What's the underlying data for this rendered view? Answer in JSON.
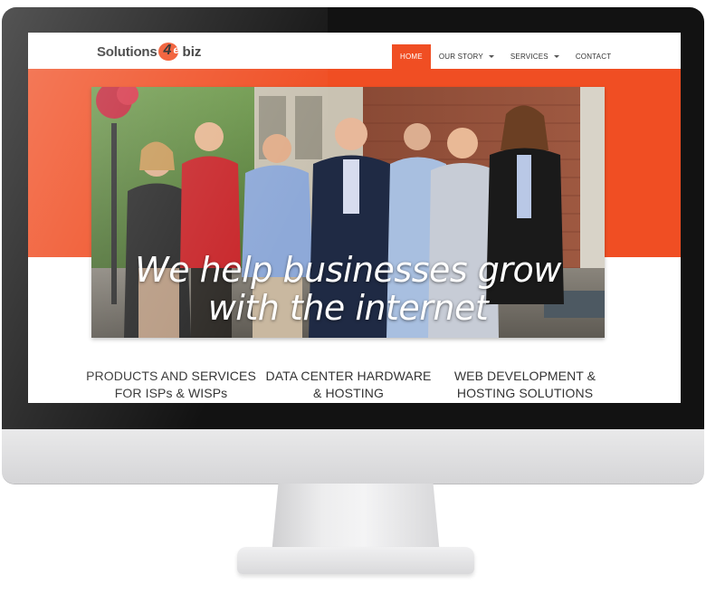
{
  "logo": {
    "text_left": "Solutions",
    "mark_number": "4",
    "mark_letter": "e",
    "text_right": "biz",
    "brand_color": "#f04e23"
  },
  "nav": {
    "items": [
      {
        "label": "HOME",
        "active": true
      },
      {
        "label": "OUR STORY",
        "has_dropdown": true,
        "icon": "chevron-down-icon"
      },
      {
        "label": "SERVICES",
        "has_dropdown": true,
        "icon": "chevron-down-icon"
      },
      {
        "label": "CONTACT"
      }
    ]
  },
  "hero": {
    "line1": "We help businesses grow",
    "line2": "with the internet",
    "image": "team-photo"
  },
  "features": [
    {
      "line1": "PRODUCTS AND SERVICES",
      "line2": "FOR ISPs & WISPs"
    },
    {
      "line1": "DATA CENTER HARDWARE",
      "line2": "& HOSTING"
    },
    {
      "line1": "WEB DEVELOPMENT &",
      "line2": "HOSTING SOLUTIONS"
    }
  ],
  "colors": {
    "accent": "#f04e23",
    "bezel": "#121212",
    "text": "#333333"
  }
}
